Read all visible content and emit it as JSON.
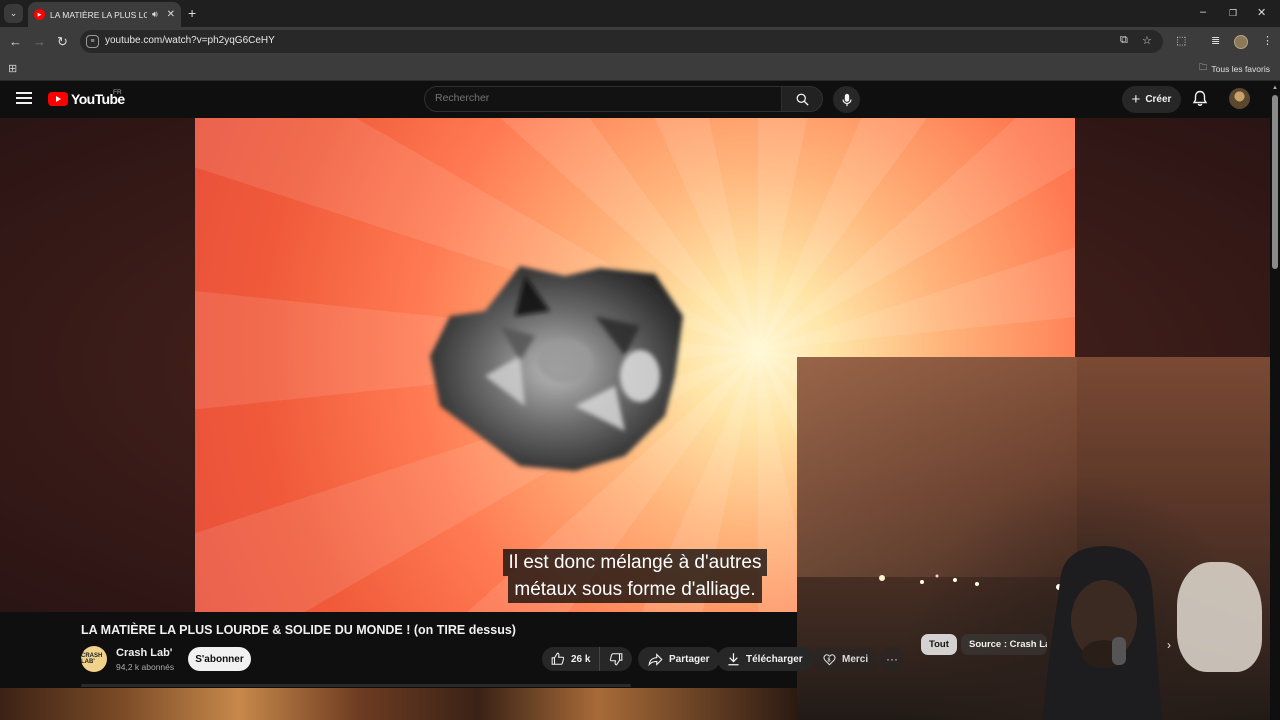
{
  "browser": {
    "tab_title": "LA MATIÈRE LA PLUS LOURDE & SOLIDE DU MONDE ! (on TIRE dessus)",
    "url": "youtube.com/watch?v=ph2yqG6CeHY",
    "bookmarks_folder": "Tous les favoris"
  },
  "youtube": {
    "logo_text": "YouTube",
    "country_code": "FR",
    "search_placeholder": "Rechercher",
    "create_label": "Créer"
  },
  "video": {
    "subtitle_lines": [
      "Il est donc mélangé à d'autres",
      "métaux sous forme d'alliage."
    ],
    "title": "LA MATIÈRE LA PLUS LOURDE & SOLIDE DU MONDE ! (on TIRE dessus)",
    "channel_name": "Crash Lab'",
    "channel_avatar_text": "CRASH LAB'",
    "subscribers": "94,2 k abonnés",
    "subscribe_label": "S'abonner",
    "likes": "26 k",
    "share_label": "Partager",
    "download_label": "Télécharger",
    "thanks_label": "Merci",
    "more_label": "···"
  },
  "chips": {
    "all": "Tout",
    "source": "Source : Crash Lab'"
  },
  "colors": {
    "youtube_red": "#ff0000",
    "background": "#0f0f0f"
  }
}
